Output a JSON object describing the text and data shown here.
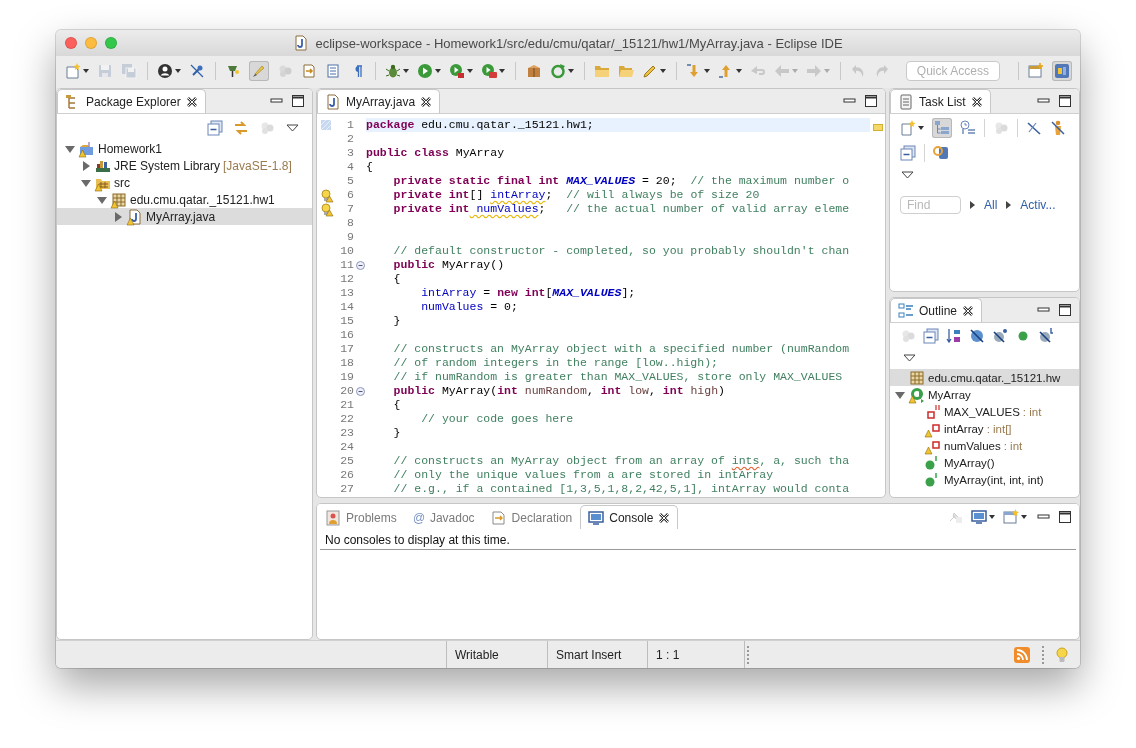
{
  "window": {
    "title": "eclipse-workspace - Homework1/src/edu/cmu/qatar/_15121/hw1/MyArray.java - Eclipse IDE"
  },
  "toolbar": {
    "buttons": [
      {
        "dropdown": true,
        "disabled": false,
        "pressed": false
      },
      {
        "dropdown": false,
        "disabled": true,
        "pressed": false
      },
      {
        "dropdown": false,
        "disabled": true,
        "pressed": false
      },
      {
        "dropdown": true,
        "disabled": false,
        "pressed": false
      },
      {
        "dropdown": false,
        "disabled": false,
        "pressed": false
      },
      {
        "dropdown": false,
        "disabled": false,
        "pressed": false
      },
      {
        "dropdown": false,
        "disabled": false,
        "pressed": true
      },
      {
        "dropdown": false,
        "disabled": true,
        "pressed": false
      },
      {
        "dropdown": false,
        "disabled": false,
        "pressed": false
      },
      {
        "dropdown": false,
        "disabled": false,
        "pressed": false
      },
      {
        "dropdown": false,
        "disabled": false,
        "pressed": false
      },
      {
        "dropdown": true,
        "disabled": false,
        "pressed": false
      },
      {
        "dropdown": true,
        "disabled": false,
        "pressed": false
      },
      {
        "dropdown": true,
        "disabled": false,
        "pressed": false
      },
      {
        "dropdown": true,
        "disabled": false,
        "pressed": false
      },
      {
        "dropdown": false,
        "disabled": false,
        "pressed": false
      },
      {
        "dropdown": true,
        "disabled": false,
        "pressed": false
      },
      {
        "dropdown": false,
        "disabled": false,
        "pressed": false
      },
      {
        "dropdown": false,
        "disabled": false,
        "pressed": false
      },
      {
        "dropdown": true,
        "disabled": false,
        "pressed": false
      },
      {
        "dropdown": true,
        "disabled": false,
        "pressed": false
      },
      {
        "dropdown": true,
        "disabled": false,
        "pressed": false
      },
      {
        "dropdown": false,
        "disabled": true,
        "pressed": false
      },
      {
        "dropdown": true,
        "disabled": true,
        "pressed": false
      },
      {
        "dropdown": true,
        "disabled": true,
        "pressed": false
      },
      {
        "dropdown": false,
        "disabled": true,
        "pressed": false
      },
      {
        "dropdown": false,
        "disabled": true,
        "pressed": false
      }
    ],
    "quick_access": {
      "placeholder": "Quick Access"
    },
    "perspectives": [
      {
        "selected": false
      },
      {
        "selected": true
      }
    ]
  },
  "package_explorer": {
    "tab": {
      "label": "Package Explorer",
      "selected": true
    },
    "tools": [
      {
        "disabled": false
      },
      {
        "disabled": false
      },
      {
        "disabled": true
      }
    ],
    "tree": [
      {
        "label": "Homework1",
        "kind": "project",
        "warning": true,
        "expanded": true,
        "selected": false,
        "children": [
          {
            "label": "JRE System Library",
            "suffix": "[JavaSE-1.8]",
            "kind": "library",
            "warning": false,
            "expanded": false,
            "selected": false
          },
          {
            "label": "src",
            "kind": "source-folder",
            "warning": true,
            "expanded": true,
            "selected": false,
            "children": [
              {
                "label": "edu.cmu.qatar._15121.hw1",
                "kind": "package",
                "warning": true,
                "expanded": true,
                "selected": false,
                "children": [
                  {
                    "label": "MyArray.java",
                    "kind": "java-file",
                    "warning": true,
                    "expanded": false,
                    "selected": true
                  }
                ]
              }
            ]
          }
        ]
      }
    ]
  },
  "editor": {
    "tab": {
      "label": "MyArray.java",
      "selected": true
    },
    "lines": [
      {
        "number": "1",
        "current": true,
        "warning": false,
        "foldable": false,
        "tokens": [
          {
            "kind": "keyword",
            "text": "package"
          },
          {
            "kind": "plain",
            "text": " edu.cmu.qatar._15121.hw1;"
          }
        ]
      },
      {
        "number": "2",
        "current": false,
        "warning": false,
        "foldable": false
      },
      {
        "number": "3",
        "current": false,
        "warning": false,
        "foldable": false,
        "tokens": [
          {
            "kind": "keyword",
            "text": "public class"
          },
          {
            "kind": "plain",
            "text": " MyArray"
          }
        ]
      },
      {
        "number": "4",
        "current": false,
        "warning": false,
        "foldable": false,
        "tokens": [
          {
            "kind": "plain",
            "text": "{"
          }
        ]
      },
      {
        "number": "5",
        "current": false,
        "warning": false,
        "foldable": false,
        "tokens": [
          {
            "kind": "keyword",
            "text": "    private static final int"
          },
          {
            "kind": "constant",
            "text": " MAX_VALUES"
          },
          {
            "kind": "plain",
            "text": " = 20;  "
          },
          {
            "kind": "comment",
            "text": "// the maximum number o"
          }
        ]
      },
      {
        "number": "6",
        "current": false,
        "warning": true,
        "foldable": false,
        "tokens": [
          {
            "kind": "keyword",
            "text": "    private int"
          },
          {
            "kind": "plain",
            "text": "[] "
          },
          {
            "kind": "field-warning",
            "text": "intArray"
          },
          {
            "kind": "plain",
            "text": ";  "
          },
          {
            "kind": "comment",
            "text": "// will always be of size 20"
          }
        ]
      },
      {
        "number": "7",
        "current": false,
        "warning": true,
        "foldable": false,
        "tokens": [
          {
            "kind": "keyword",
            "text": "    private int"
          },
          {
            "kind": "field-warning",
            "text": " numValues"
          },
          {
            "kind": "plain",
            "text": ";   "
          },
          {
            "kind": "comment",
            "text": "// the actual number of valid array eleme"
          }
        ]
      },
      {
        "number": "8",
        "current": false,
        "warning": false,
        "foldable": false
      },
      {
        "number": "9",
        "current": false,
        "warning": false,
        "foldable": false
      },
      {
        "number": "10",
        "current": false,
        "warning": false,
        "foldable": false,
        "tokens": [
          {
            "kind": "comment",
            "text": "    // default constructor - completed, so you probably shouldn't chan"
          }
        ]
      },
      {
        "number": "11",
        "current": false,
        "warning": false,
        "foldable": true,
        "tokens": [
          {
            "kind": "keyword",
            "text": "    public"
          },
          {
            "kind": "plain",
            "text": " MyArray()"
          }
        ]
      },
      {
        "number": "12",
        "current": false,
        "warning": false,
        "foldable": false,
        "tokens": [
          {
            "kind": "plain",
            "text": "    {"
          }
        ]
      },
      {
        "number": "13",
        "current": false,
        "warning": false,
        "foldable": false,
        "tokens": [
          {
            "kind": "field",
            "text": "        intArray"
          },
          {
            "kind": "plain",
            "text": " = "
          },
          {
            "kind": "keyword",
            "text": "new int"
          },
          {
            "kind": "plain",
            "text": "["
          },
          {
            "kind": "constant",
            "text": "MAX_VALUES"
          },
          {
            "kind": "plain",
            "text": "];"
          }
        ]
      },
      {
        "number": "14",
        "current": false,
        "warning": false,
        "foldable": false,
        "tokens": [
          {
            "kind": "field",
            "text": "        numValues"
          },
          {
            "kind": "plain",
            "text": " = 0;"
          }
        ]
      },
      {
        "number": "15",
        "current": false,
        "warning": false,
        "foldable": false,
        "tokens": [
          {
            "kind": "plain",
            "text": "    }"
          }
        ]
      },
      {
        "number": "16",
        "current": false,
        "warning": false,
        "foldable": false
      },
      {
        "number": "17",
        "current": false,
        "warning": false,
        "foldable": false,
        "tokens": [
          {
            "kind": "comment",
            "text": "    // constructs an MyArray object with a specified number (numRandom"
          }
        ]
      },
      {
        "number": "18",
        "current": false,
        "warning": false,
        "foldable": false,
        "tokens": [
          {
            "kind": "comment",
            "text": "    // of random integers in the range [low..high);"
          }
        ]
      },
      {
        "number": "19",
        "current": false,
        "warning": false,
        "foldable": false,
        "tokens": [
          {
            "kind": "comment",
            "text": "    // if numRandom is greater than MAX_VALUES, store only MAX_VALUES"
          }
        ]
      },
      {
        "number": "20",
        "current": false,
        "warning": false,
        "foldable": true,
        "tokens": [
          {
            "kind": "keyword",
            "text": "    public"
          },
          {
            "kind": "plain",
            "text": " MyArray("
          },
          {
            "kind": "keyword",
            "text": "int"
          },
          {
            "kind": "parameter",
            "text": " numRandom"
          },
          {
            "kind": "plain",
            "text": ", "
          },
          {
            "kind": "keyword",
            "text": "int"
          },
          {
            "kind": "parameter",
            "text": " low"
          },
          {
            "kind": "plain",
            "text": ", "
          },
          {
            "kind": "keyword",
            "text": "int"
          },
          {
            "kind": "parameter",
            "text": " high"
          },
          {
            "kind": "plain",
            "text": ")"
          }
        ]
      },
      {
        "number": "21",
        "current": false,
        "warning": false,
        "foldable": false,
        "tokens": [
          {
            "kind": "plain",
            "text": "    {"
          }
        ]
      },
      {
        "number": "22",
        "current": false,
        "warning": false,
        "foldable": false,
        "tokens": [
          {
            "kind": "comment",
            "text": "        // your code goes here"
          }
        ]
      },
      {
        "number": "23",
        "current": false,
        "warning": false,
        "foldable": false,
        "tokens": [
          {
            "kind": "plain",
            "text": "    }"
          }
        ]
      },
      {
        "number": "24",
        "current": false,
        "warning": false,
        "foldable": false
      },
      {
        "number": "25",
        "current": false,
        "warning": false,
        "foldable": false,
        "tokens": [
          {
            "kind": "comment",
            "text": "    // constructs an MyArray object from an array of "
          },
          {
            "kind": "comment-misspelled",
            "text": "ints"
          },
          {
            "kind": "comment",
            "text": ", a, such tha"
          }
        ]
      },
      {
        "number": "26",
        "current": false,
        "warning": false,
        "foldable": false,
        "tokens": [
          {
            "kind": "comment",
            "text": "    // only the unique values from a are stored in intArray"
          }
        ]
      },
      {
        "number": "27",
        "current": false,
        "warning": false,
        "foldable": false,
        "tokens": [
          {
            "kind": "comment",
            "text": "    // e.g., if a contained [1,3,5,1,8,2,42,5,1], intArray would conta"
          }
        ]
      }
    ]
  },
  "task_list": {
    "tab": {
      "label": "Task List",
      "selected": true
    },
    "tools": [
      {
        "dropdown": true,
        "disabled": false,
        "pressed": false
      },
      {
        "dropdown": false,
        "disabled": false,
        "pressed": true
      },
      {
        "dropdown": false,
        "disabled": false,
        "pressed": false
      },
      {
        "dropdown": false,
        "disabled": true,
        "pressed": false
      },
      {
        "dropdown": false,
        "disabled": false,
        "pressed": false
      },
      {
        "dropdown": false,
        "disabled": false,
        "pressed": false
      },
      {
        "dropdown": false,
        "disabled": false,
        "pressed": false
      },
      {
        "dropdown": false,
        "disabled": false,
        "pressed": false
      }
    ],
    "find": {
      "placeholder": "Find"
    },
    "filters": [
      {
        "label": "All"
      },
      {
        "label": "Activ..."
      }
    ]
  },
  "outline": {
    "tab": {
      "label": "Outline",
      "selected": true
    },
    "tools": [
      {
        "disabled": true
      },
      {
        "disabled": false
      },
      {
        "disabled": false
      },
      {
        "disabled": false
      },
      {
        "disabled": false
      },
      {
        "disabled": false
      },
      {
        "disabled": false
      }
    ],
    "items": [
      {
        "label": "edu.cmu.qatar._15121.hw",
        "kind": "package",
        "warning": false,
        "selected": true
      },
      {
        "label": "MyArray",
        "kind": "class",
        "warning": true,
        "expanded": true,
        "selected": false,
        "children": [
          {
            "label": "MAX_VALUES",
            "type": " : int",
            "kind": "constant",
            "warning": false,
            "selected": false
          },
          {
            "label": "intArray",
            "type": " : int[]",
            "kind": "field",
            "warning": true,
            "selected": false
          },
          {
            "label": "numValues",
            "type": " : int",
            "kind": "field",
            "warning": true,
            "selected": false
          },
          {
            "label": "MyArray()",
            "kind": "constructor",
            "warning": false,
            "selected": false
          },
          {
            "label": "MyArray(int, int, int)",
            "kind": "constructor",
            "warning": false,
            "selected": false
          }
        ]
      }
    ]
  },
  "bottom_panel": {
    "tabs": [
      {
        "label": "Problems",
        "selected": false
      },
      {
        "label": "Javadoc",
        "glyph": "@",
        "selected": false
      },
      {
        "label": "Declaration",
        "selected": false
      },
      {
        "label": "Console",
        "selected": true
      }
    ],
    "tools": [
      {
        "dropdown": false,
        "disabled": true
      },
      {
        "dropdown": true,
        "disabled": false
      },
      {
        "dropdown": true,
        "disabled": false
      }
    ],
    "message": "No consoles to display at this time."
  },
  "status_bar": {
    "fields": [
      "Writable",
      "Smart Insert",
      "1 : 1"
    ]
  }
}
